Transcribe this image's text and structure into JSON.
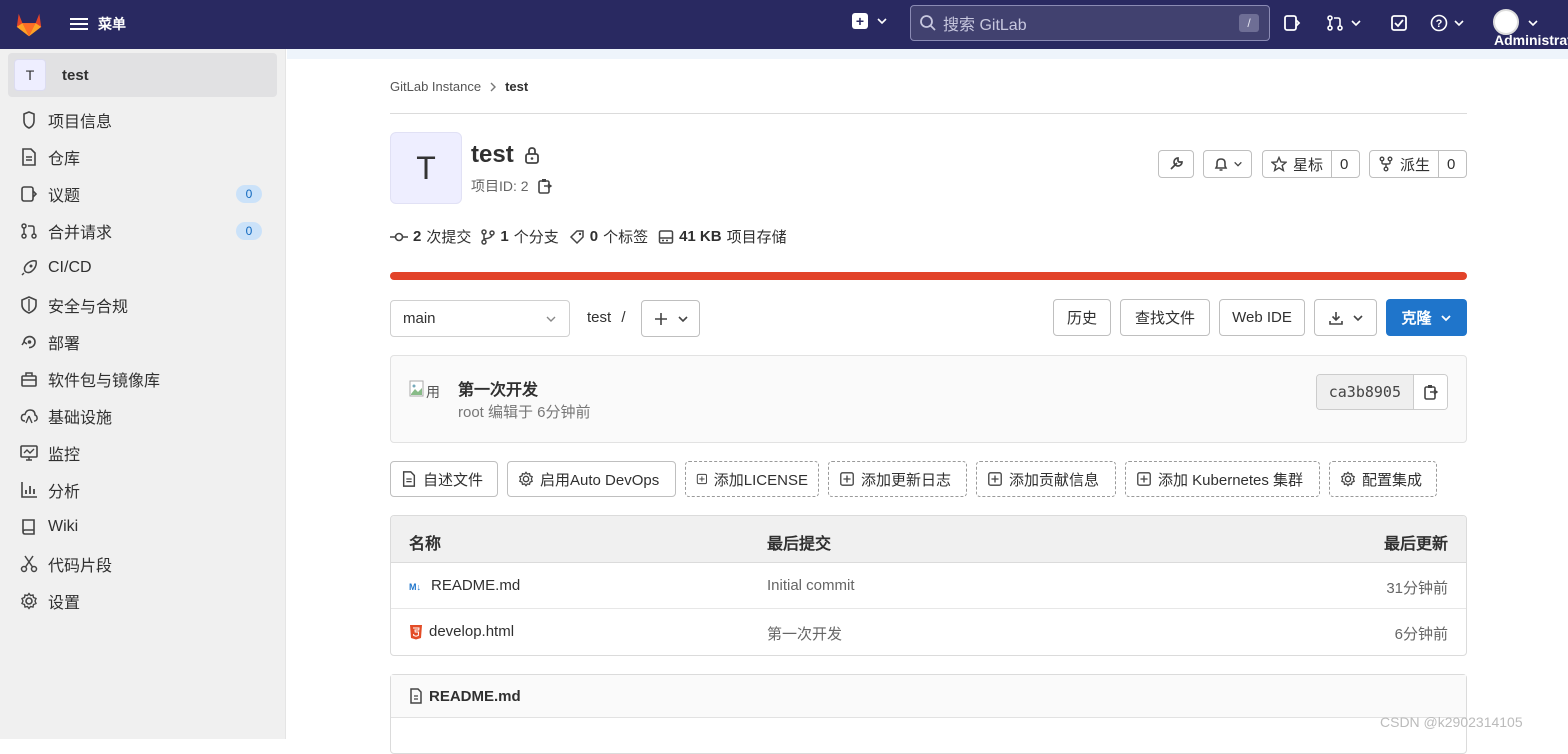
{
  "topbar": {
    "menu_label": "菜单",
    "search_placeholder": "搜索 GitLab",
    "search_shortcut": "/",
    "user_name": "Administrator",
    "bg_color": "#292961"
  },
  "sidebar": {
    "project_avatar": "T",
    "project_name": "test",
    "items": [
      {
        "label": "项目信息",
        "icon": "info-icon"
      },
      {
        "label": "仓库",
        "icon": "repository-icon"
      },
      {
        "label": "议题",
        "icon": "issues-icon",
        "badge": "0"
      },
      {
        "label": "合并请求",
        "icon": "merge-request-icon",
        "badge": "0"
      },
      {
        "label": "CI/CD",
        "icon": "rocket-icon"
      },
      {
        "label": "安全与合规",
        "icon": "shield-icon"
      },
      {
        "label": "部署",
        "icon": "deploy-icon"
      },
      {
        "label": "软件包与镜像库",
        "icon": "package-icon"
      },
      {
        "label": "基础设施",
        "icon": "cloud-icon"
      },
      {
        "label": "监控",
        "icon": "monitor-icon"
      },
      {
        "label": "分析",
        "icon": "chart-icon"
      },
      {
        "label": "Wiki",
        "icon": "book-icon"
      },
      {
        "label": "代码片段",
        "icon": "snippet-icon"
      },
      {
        "label": "设置",
        "icon": "gear-icon"
      }
    ]
  },
  "breadcrumb": {
    "root": "GitLab Instance",
    "current": "test"
  },
  "project": {
    "avatar_letter": "T",
    "name": "test",
    "id_label": "项目ID: 2",
    "star_label": "星标",
    "star_count": "0",
    "fork_label": "派生",
    "fork_count": "0"
  },
  "stats": {
    "commits_num": "2",
    "commits_label": "次提交",
    "branches_num": "1",
    "branches_label": "个分支",
    "tags_num": "0",
    "tags_label": "个标签",
    "storage_num": "41 KB",
    "storage_label": "项目存储",
    "storage_bar_fraction": 1.0,
    "storage_bar_color": "#e24329"
  },
  "repo_toolbar": {
    "branch": "main",
    "path": "test",
    "path_sep": "/",
    "history": "历史",
    "find_file": "查找文件",
    "web_ide": "Web IDE",
    "clone": "克隆",
    "clone_color": "#1f75cb"
  },
  "last_commit": {
    "avatar_alt": "用",
    "title": "第一次开发",
    "meta": "root 编辑于 6分钟前",
    "sha": "ca3b8905"
  },
  "quick_actions": [
    {
      "label": "自述文件",
      "icon": "file-icon",
      "style": "solid"
    },
    {
      "label": "启用Auto DevOps",
      "icon": "gear-icon",
      "style": "solid"
    },
    {
      "label": "添加LICENSE",
      "icon": "plus-square-icon",
      "style": "dash"
    },
    {
      "label": "添加更新日志",
      "icon": "plus-square-icon",
      "style": "dash"
    },
    {
      "label": "添加贡献信息",
      "icon": "plus-square-icon",
      "style": "dash"
    },
    {
      "label": "添加 Kubernetes 集群",
      "icon": "plus-square-icon",
      "style": "dash"
    },
    {
      "label": "配置集成",
      "icon": "gear-icon",
      "style": "dash"
    }
  ],
  "file_table": {
    "headers": [
      "名称",
      "最后提交",
      "最后更新"
    ],
    "rows": [
      {
        "name": "README.md",
        "icon": "markdown-icon",
        "commit": "Initial commit",
        "updated": "31分钟前"
      },
      {
        "name": "develop.html",
        "icon": "html5-icon",
        "commit": "第一次开发",
        "updated": "6分钟前"
      }
    ]
  },
  "readme": {
    "title": "README.md"
  },
  "watermark": "CSDN @k2902314105"
}
